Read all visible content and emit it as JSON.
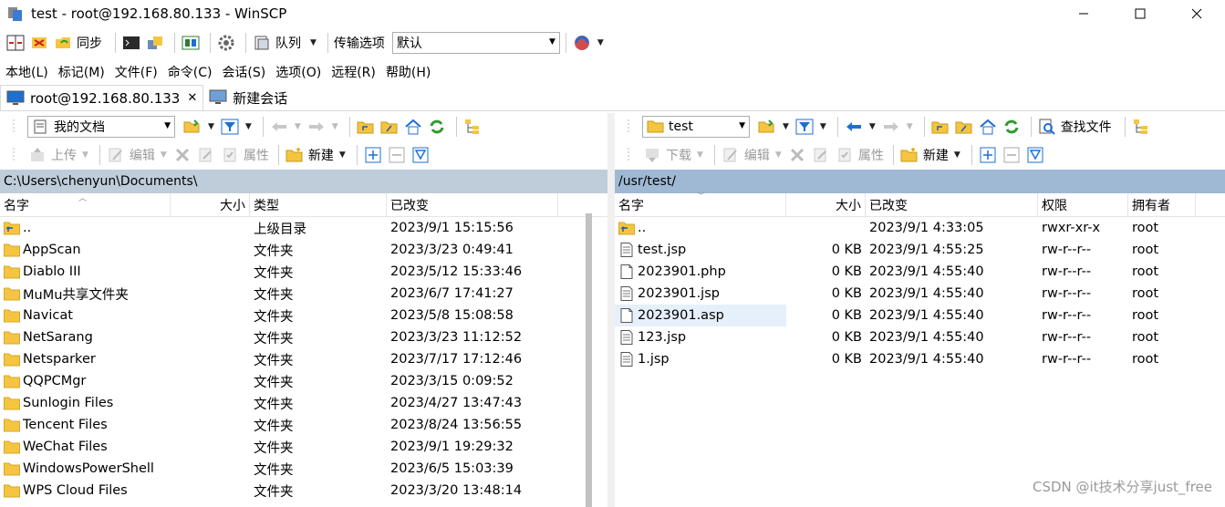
{
  "window": {
    "title": "test - root@192.168.80.133 - WinSCP"
  },
  "toolbar": {
    "sync_label": "同步",
    "queue_label": "队列",
    "transfer_options_label": "传输选项",
    "transfer_preset": "默认"
  },
  "menu": [
    "本地(L)",
    "标记(M)",
    "文件(F)",
    "命令(C)",
    "会话(S)",
    "选项(O)",
    "远程(R)",
    "帮助(H)"
  ],
  "tabs": {
    "session": "root@192.168.80.133",
    "new_session": "新建会话"
  },
  "left": {
    "location": "我的文档",
    "toolbar": {
      "upload": "上传",
      "edit": "编辑",
      "properties": "属性",
      "new": "新建"
    },
    "path": "C:\\Users\\chenyun\\Documents\\",
    "columns": {
      "name": "名字",
      "size": "大小",
      "type": "类型",
      "changed": "已改变"
    },
    "rows": [
      {
        "name": "..",
        "size": "",
        "type": "上级目录",
        "changed": "2023/9/1  15:15:56",
        "kind": "up"
      },
      {
        "name": "AppScan",
        "size": "",
        "type": "文件夹",
        "changed": "2023/3/23  0:49:41",
        "kind": "folder"
      },
      {
        "name": "Diablo III",
        "size": "",
        "type": "文件夹",
        "changed": "2023/5/12  15:33:46",
        "kind": "folder"
      },
      {
        "name": "MuMu共享文件夹",
        "size": "",
        "type": "文件夹",
        "changed": "2023/6/7  17:41:27",
        "kind": "folder"
      },
      {
        "name": "Navicat",
        "size": "",
        "type": "文件夹",
        "changed": "2023/5/8  15:08:58",
        "kind": "folder"
      },
      {
        "name": "NetSarang",
        "size": "",
        "type": "文件夹",
        "changed": "2023/3/23  11:12:52",
        "kind": "folder"
      },
      {
        "name": "Netsparker",
        "size": "",
        "type": "文件夹",
        "changed": "2023/7/17  17:12:46",
        "kind": "folder"
      },
      {
        "name": "QQPCMgr",
        "size": "",
        "type": "文件夹",
        "changed": "2023/3/15  0:09:52",
        "kind": "folder"
      },
      {
        "name": "Sunlogin Files",
        "size": "",
        "type": "文件夹",
        "changed": "2023/4/27  13:47:43",
        "kind": "folder"
      },
      {
        "name": "Tencent Files",
        "size": "",
        "type": "文件夹",
        "changed": "2023/8/24  13:56:55",
        "kind": "folder"
      },
      {
        "name": "WeChat Files",
        "size": "",
        "type": "文件夹",
        "changed": "2023/9/1  19:29:32",
        "kind": "folder"
      },
      {
        "name": "WindowsPowerShell",
        "size": "",
        "type": "文件夹",
        "changed": "2023/6/5  15:03:39",
        "kind": "folder"
      },
      {
        "name": "WPS Cloud Files",
        "size": "",
        "type": "文件夹",
        "changed": "2023/3/20  13:48:14",
        "kind": "folder"
      }
    ]
  },
  "right": {
    "location": "test",
    "find_files": "查找文件",
    "toolbar": {
      "download": "下载",
      "edit": "编辑",
      "properties": "属性",
      "new": "新建"
    },
    "path": "/usr/test/",
    "columns": {
      "name": "名字",
      "size": "大小",
      "changed": "已改变",
      "rights": "权限",
      "owner": "拥有者"
    },
    "rows": [
      {
        "name": "..",
        "size": "",
        "changed": "2023/9/1 4:33:05",
        "rights": "rwxr-xr-x",
        "owner": "root",
        "kind": "up"
      },
      {
        "name": "test.jsp",
        "size": "0 KB",
        "changed": "2023/9/1 4:55:25",
        "rights": "rw-r--r--",
        "owner": "root",
        "kind": "textfile"
      },
      {
        "name": "2023901.php",
        "size": "0 KB",
        "changed": "2023/9/1 4:55:40",
        "rights": "rw-r--r--",
        "owner": "root",
        "kind": "file"
      },
      {
        "name": "2023901.jsp",
        "size": "0 KB",
        "changed": "2023/9/1 4:55:40",
        "rights": "rw-r--r--",
        "owner": "root",
        "kind": "textfile"
      },
      {
        "name": "2023901.asp",
        "size": "0 KB",
        "changed": "2023/9/1 4:55:40",
        "rights": "rw-r--r--",
        "owner": "root",
        "kind": "file",
        "selected": true
      },
      {
        "name": "123.jsp",
        "size": "0 KB",
        "changed": "2023/9/1 4:55:40",
        "rights": "rw-r--r--",
        "owner": "root",
        "kind": "textfile"
      },
      {
        "name": "1.jsp",
        "size": "0 KB",
        "changed": "2023/9/1 4:55:40",
        "rights": "rw-r--r--",
        "owner": "root",
        "kind": "textfile"
      }
    ]
  },
  "watermark": "CSDN @it技术分享just_free",
  "colors": {
    "folder": "#f5c542",
    "accent": "#1e6fd0",
    "left_path_bg": "#bfcddb",
    "right_path_bg": "#9fb8d4",
    "selection": "#e5f0fb"
  }
}
